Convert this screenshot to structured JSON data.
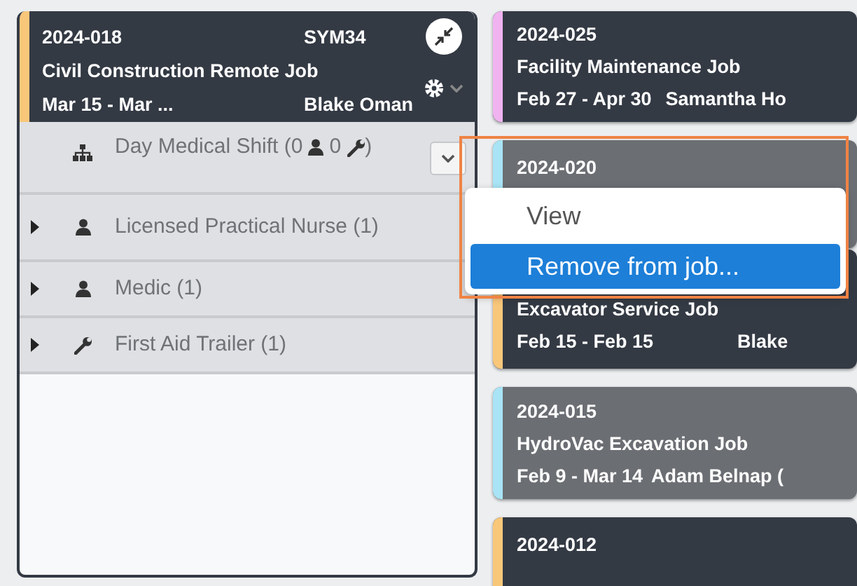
{
  "main_job": {
    "number": "2024-018",
    "code": "SYM34",
    "title": "Civil Construction Remote Job",
    "dates": "Mar 15 - Mar ...",
    "manager": "Blake Oman",
    "color": "#f9c77a"
  },
  "resource_rows": [
    {
      "kind": "group",
      "label": "Day Medical Shift (0",
      "person_count": "0",
      "closing": ")",
      "menu_open": true
    },
    {
      "kind": "person",
      "label": "Licensed Practical Nurse (1)",
      "expanded": false
    },
    {
      "kind": "person",
      "label": "Medic (1)",
      "expanded": false
    },
    {
      "kind": "equipment",
      "label": "First Aid Trailer (1)",
      "expanded": false
    }
  ],
  "context_menu": {
    "items": [
      {
        "label": "View",
        "selected": false
      },
      {
        "label": "Remove from job...",
        "selected": true
      }
    ]
  },
  "other_jobs": [
    {
      "number": "2024-025",
      "title": "Facility Maintenance Job",
      "dates": "Feb 27 - Apr 30",
      "manager": "Samantha Ho",
      "color": "#f0b3f0",
      "muted": false
    },
    {
      "number": "2024-020",
      "color": "#a8e4f5",
      "muted": true
    },
    {
      "title": "Excavator Service Job",
      "dates": "Feb 15 - Feb 15",
      "manager": "Blake",
      "color": "#f9c77a",
      "muted": false
    },
    {
      "number": "2024-015",
      "title": "HydroVac Excavation Job",
      "dates": "Feb 9 - Mar 14",
      "manager": "Adam Belnap (",
      "color": "#a8e4f5",
      "muted": true
    },
    {
      "number": "2024-012",
      "color": "#f9c77a",
      "muted": false
    }
  ]
}
